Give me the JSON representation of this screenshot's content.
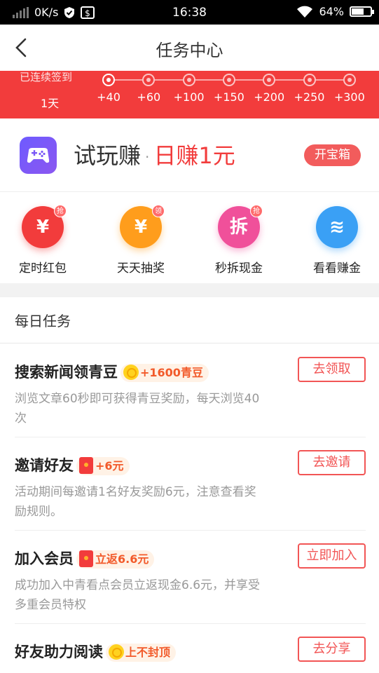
{
  "status_bar": {
    "speed": "0K/s",
    "time": "16:38",
    "battery": "64%",
    "battery_level": 0.64
  },
  "header": {
    "title": "任务中心"
  },
  "checkin": {
    "label": "已连续签到",
    "days": "1天",
    "rewards": [
      "+40",
      "+60",
      "+100",
      "+150",
      "+200",
      "+250",
      "+300"
    ],
    "active_index": 0
  },
  "tryplay": {
    "title": "试玩赚",
    "separator": "·",
    "highlight": "日赚1元",
    "button": "开宝箱",
    "accent": "#f23c3c"
  },
  "quick_entries": [
    {
      "label": "定时红包",
      "icon": "red-envelope-icon",
      "glyph": "¥",
      "badge": "抢",
      "color": "#f23c3c"
    },
    {
      "label": "天天抽奖",
      "icon": "lottery-icon",
      "glyph": "¥",
      "badge": "领",
      "color": "#ff9d1c"
    },
    {
      "label": "秒拆现金",
      "icon": "cash-icon",
      "glyph": "拆",
      "badge": "抢",
      "color": "#f0509a"
    },
    {
      "label": "看看赚金",
      "icon": "coins-icon",
      "glyph": "≋",
      "badge": "",
      "color": "#3aa0f5"
    }
  ],
  "daily": {
    "title": "每日任务",
    "tasks": [
      {
        "name": "搜索新闻领青豆",
        "reward": "+1600青豆",
        "reward_icon": "coin",
        "desc": "浏览文章60秒即可获得青豆奖励，每天浏览40次",
        "button": "去领取"
      },
      {
        "name": "邀请好友",
        "reward": "+6元",
        "reward_icon": "envelope",
        "desc": "活动期间每邀请1名好友奖励6元，注意查看奖励规则。",
        "button": "去邀请"
      },
      {
        "name": "加入会员",
        "reward": "立返6.6元",
        "reward_icon": "envelope",
        "desc": "成功加入中青看点会员立返现金6.6元，并享受多重会员特权",
        "button": "立即加入"
      },
      {
        "name": "好友助力阅读",
        "reward": "上不封顶",
        "reward_icon": "coin",
        "desc": "",
        "button": "去分享"
      }
    ]
  }
}
